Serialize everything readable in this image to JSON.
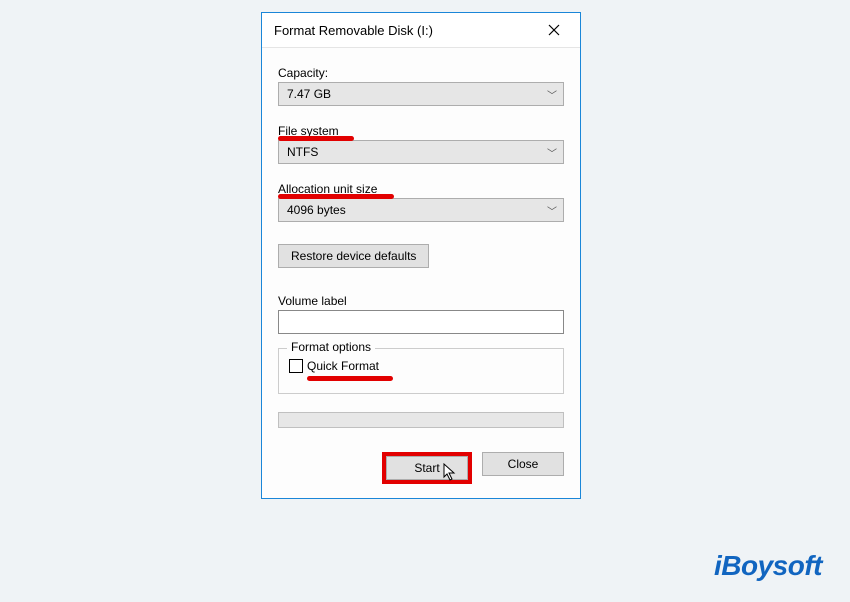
{
  "dialog": {
    "title": "Format Removable Disk (I:)",
    "capacity_label": "Capacity:",
    "capacity_value": "7.47 GB",
    "filesystem_label": "File system",
    "filesystem_value": "NTFS",
    "allocation_label": "Allocation unit size",
    "allocation_value": "4096 bytes",
    "restore_label": "Restore device defaults",
    "volume_label": "Volume label",
    "volume_value": "",
    "format_options_label": "Format options",
    "quick_format_label": "Quick Format",
    "start_label": "Start",
    "close_label": "Close"
  },
  "watermark": "iBoysoft"
}
